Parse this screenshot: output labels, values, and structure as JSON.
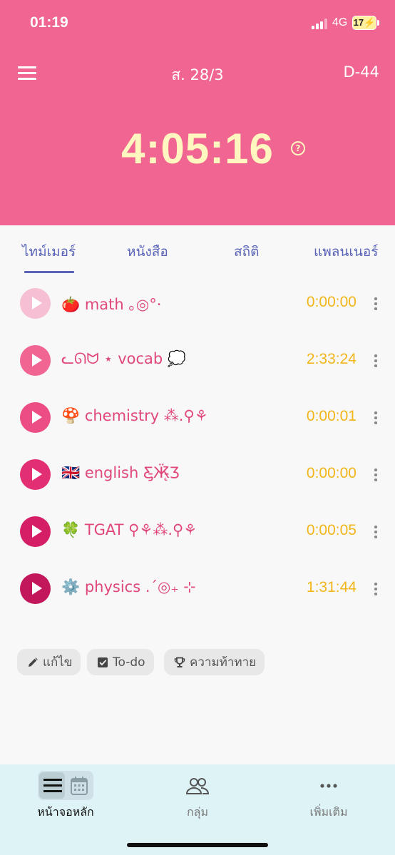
{
  "status_bar": {
    "time": "01:19",
    "network": "4G",
    "battery": "17"
  },
  "header": {
    "date": "ส. 28/3",
    "countdown": "D-44",
    "total_time": "4:05:16",
    "help_icon": "?"
  },
  "tabs": [
    {
      "label": "ไทม์เมอร์",
      "active": true
    },
    {
      "label": "หนังสือ",
      "active": false
    },
    {
      "label": "สถิติ",
      "active": false
    },
    {
      "label": "แพลนเนอร์",
      "active": false
    }
  ],
  "subjects": [
    {
      "name": "🍅 math ｡◎°·",
      "time": "0:00:00",
      "play_color": "#f7bfd3"
    },
    {
      "name": "ᓚᘏᗢ ⋆ vocab 💭",
      "time": "2:33:24",
      "play_color": "#f06592"
    },
    {
      "name": "🍄 chemistry ⁂.⚲⚘",
      "time": "0:00:01",
      "play_color": "#ec4d84"
    },
    {
      "name": "🇬🇧 english Ƹ̵̡Ӝ̵̨̄Ʒ",
      "time": "0:00:00",
      "play_color": "#e22e73"
    },
    {
      "name": "🍀 TGAT ⚲⚘⁂.⚲⚘",
      "time": "0:00:05",
      "play_color": "#d41f66"
    },
    {
      "name": "⚙️ physics .ˊ◎₊ ⊹",
      "time": "1:31:44",
      "play_color": "#c2185b"
    }
  ],
  "actions": {
    "edit": "แก้ไข",
    "todo": "To-do",
    "challenge": "ความท้าทาย"
  },
  "bottom_nav": {
    "home": "หน้าจอหลัก",
    "group": "กลุ่ม",
    "more": "เพิ่มเติม"
  },
  "colors": {
    "header_bg": "#f06592",
    "timer_text": "#fff6c0",
    "tab_accent": "#5a64b8",
    "subject_text": "#e0477c",
    "subject_time": "#f2b51b",
    "nav_bg": "#def3f6"
  },
  "icons": {
    "menu": "menu-icon",
    "help": "help-circle-icon",
    "play": "play-icon",
    "more": "more-vertical-icon",
    "edit": "pencil-icon",
    "todo": "checkbox-icon",
    "challenge": "trophy-icon",
    "home": "home-list-icon",
    "calendar": "calendar-icon",
    "group": "group-icon",
    "more_nav": "more-horizontal-icon"
  }
}
